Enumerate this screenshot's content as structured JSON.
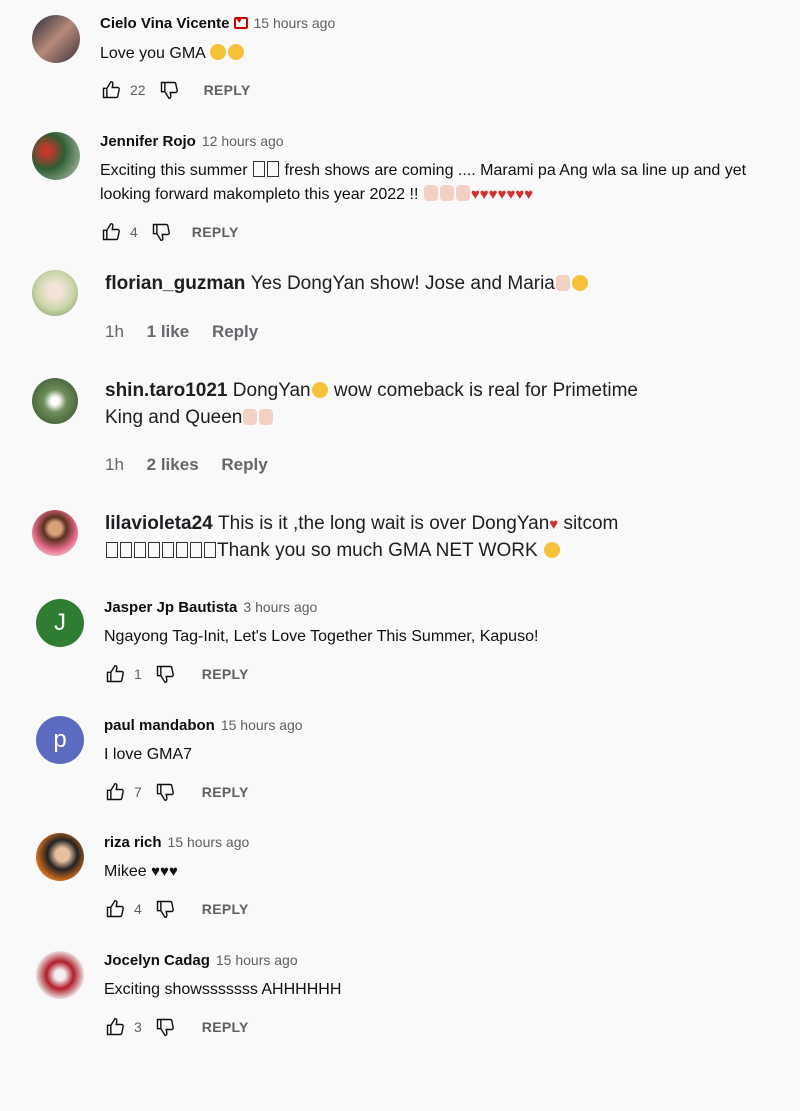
{
  "comments": [
    {
      "author": "Cielo Vina Vicente",
      "time": "15 hours ago",
      "text": "Love you GMA",
      "likes": "22",
      "reply": "REPLY"
    },
    {
      "author": "Jennifer Rojo",
      "time": "12 hours ago",
      "text1": "Exciting this summer",
      "text1b": "fresh shows are coming .... Marami pa Ang wla sa line up and yet",
      "text2": "looking forward makompleto this year 2022 !!",
      "likes": "4",
      "reply": "REPLY"
    },
    {
      "author": "florian_guzman",
      "text": "Yes DongYan show! Jose and Maria",
      "time": "1h",
      "likes": "1 like",
      "reply": "Reply"
    },
    {
      "author": "shin.taro1021",
      "text1": "DongYan",
      "text1b": "wow comeback is real for Primetime",
      "text2": "King and Queen",
      "time": "1h",
      "likes": "2 likes",
      "reply": "Reply"
    },
    {
      "author": "lilavioleta24",
      "text1": "This is it ,the long wait is over DongYan",
      "text1b": "sitcom",
      "text2": "Thank you so much GMA NET WORK"
    },
    {
      "author": "Jasper Jp Bautista",
      "time": "3 hours ago",
      "text": "Ngayong Tag-Init, Let's Love Together This Summer, Kapuso!",
      "likes": "1",
      "reply": "REPLY",
      "initial": "J"
    },
    {
      "author": "paul mandabon",
      "time": "15 hours ago",
      "text": "I love GMA7",
      "likes": "7",
      "reply": "REPLY",
      "initial": "p"
    },
    {
      "author": "riza rich",
      "time": "15 hours ago",
      "text": "Mikee",
      "likes": "4",
      "reply": "REPLY"
    },
    {
      "author": "Jocelyn Cadag",
      "time": "15 hours ago",
      "text": "Exciting showsssssss AHHHHHH",
      "likes": "3",
      "reply": "REPLY"
    }
  ],
  "icons": {
    "like": "thumbs-up-icon",
    "dislike": "thumbs-down-icon"
  },
  "colors": {
    "jasper_avatar": "#2e7d32",
    "paul_avatar": "#5c6bc0",
    "meta_gray": "#606060"
  }
}
